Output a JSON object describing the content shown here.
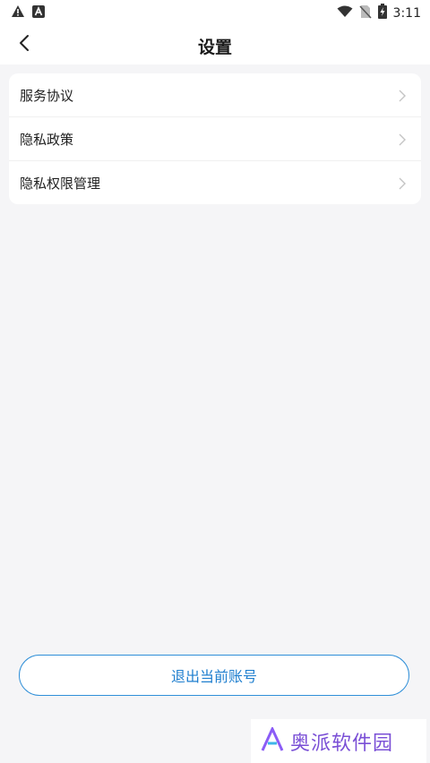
{
  "status_bar": {
    "time": "3:11",
    "icons": [
      "warning-icon",
      "a-icon",
      "wifi-icon",
      "no-sim-icon",
      "battery-charging-icon"
    ]
  },
  "nav": {
    "title": "设置",
    "back_icon": "chevron-left-icon"
  },
  "menu": {
    "items": [
      {
        "label": "服务协议"
      },
      {
        "label": "隐私政策"
      },
      {
        "label": "隐私权限管理"
      }
    ],
    "chevron_icon": "chevron-right-icon"
  },
  "logout_label": "退出当前账号",
  "watermark": {
    "text": "奥派软件园"
  },
  "colors": {
    "accent": "#2f8fd8",
    "background": "#f5f5f7",
    "watermark": "#7a4fd6"
  }
}
